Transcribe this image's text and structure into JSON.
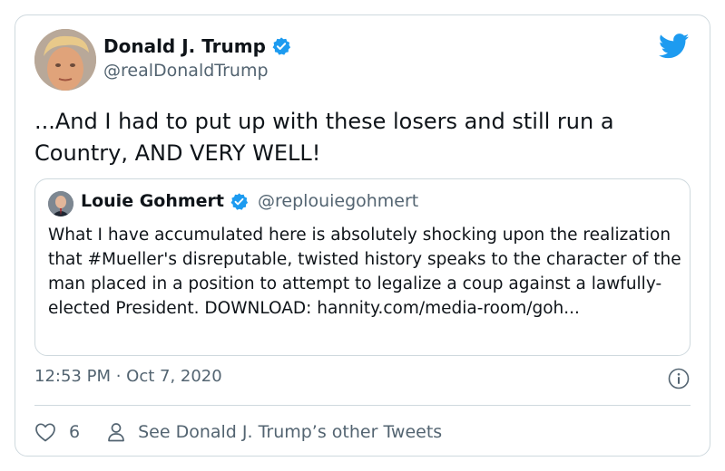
{
  "tweet": {
    "author_name": "Donald J. Trump",
    "author_handle": "@realDonaldTrump",
    "text": "...And I had to put up with these losers and still run a Country, AND VERY WELL!",
    "timestamp": "12:53 PM · Oct 7, 2020",
    "like_count": "6",
    "see_more_label": "See Donald J. Trump’s other Tweets"
  },
  "quoted": {
    "author_name": "Louie Gohmert",
    "author_handle": "@replouiegohmert",
    "text": "What I have accumulated here is absolutely shocking upon the realization that #Mueller's disreputable, twisted history speaks to the character of the man placed in a position to attempt to legalize a coup against a lawfully-elected President. DOWNLOAD: hannity.com/media-room/goh..."
  },
  "colors": {
    "verified": "#1d9bf0",
    "twitter_blue": "#1d9bf0",
    "secondary_text": "#536471",
    "border": "#cfd9de"
  },
  "icons": [
    "verified-badge-icon",
    "twitter-bird-icon",
    "info-icon",
    "heart-icon",
    "person-icon"
  ]
}
